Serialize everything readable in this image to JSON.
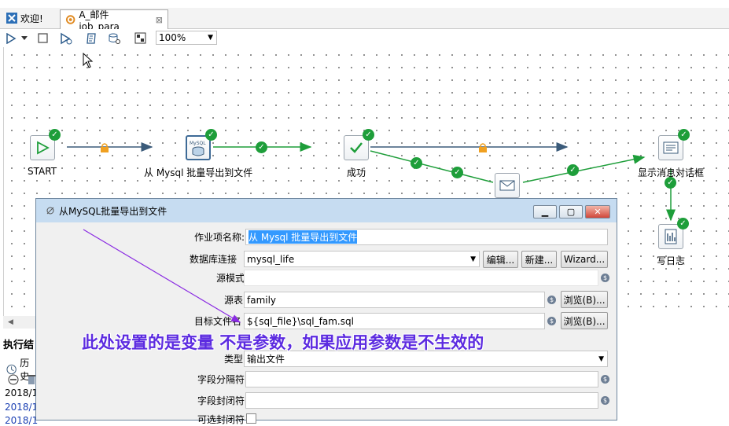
{
  "tabs": [
    {
      "label": "欢迎!",
      "icon": "welcome-icon"
    },
    {
      "label": "A_邮件job_para",
      "icon": "job-icon",
      "close": "⊠"
    }
  ],
  "toolbar": {
    "zoom": "100%"
  },
  "flow": {
    "nodes": {
      "start": "START",
      "mysql": "从 Mysql 批量导出到文件",
      "mysql_icon": "MySQL",
      "success": "成功",
      "dialog": "显示消息对话框",
      "log": "写日志"
    }
  },
  "bottom": {
    "title": "执行结",
    "history": "历史",
    "rows": [
      "2018/1",
      "2018/1",
      "2018/1"
    ]
  },
  "dialog": {
    "title": "从MySQL批量导出到文件",
    "fields": {
      "job_name_label": "作业项名称:",
      "job_name_value": "从 Mysql 批量导出到文件",
      "db_conn_label": "数据库连接",
      "db_conn_value": "mysql_life",
      "edit_btn": "编辑...",
      "new_btn": "新建...",
      "wizard_btn": "Wizard...",
      "schema_label": "源模式",
      "schema_value": "",
      "table_label": "源表",
      "table_value": "family",
      "browse1": "浏览(B)...",
      "target_label": "目标文件名",
      "target_value": "${sql_file}\\sql_fam.sql",
      "browse2": "浏览(B)...",
      "type_label": "类型",
      "type_value": "输出文件",
      "sep_label": "字段分隔符",
      "enclose_label": "字段封闭符",
      "optional_label": "可选封闭符"
    }
  },
  "annotation": "此处设置的是变量 不是参数，如果应用参数是不生效的",
  "colors": {
    "ok": "#1e9e3a",
    "lock": "#f0a020",
    "annotation": "#5c2be0",
    "arrow": "#8a2be2"
  }
}
